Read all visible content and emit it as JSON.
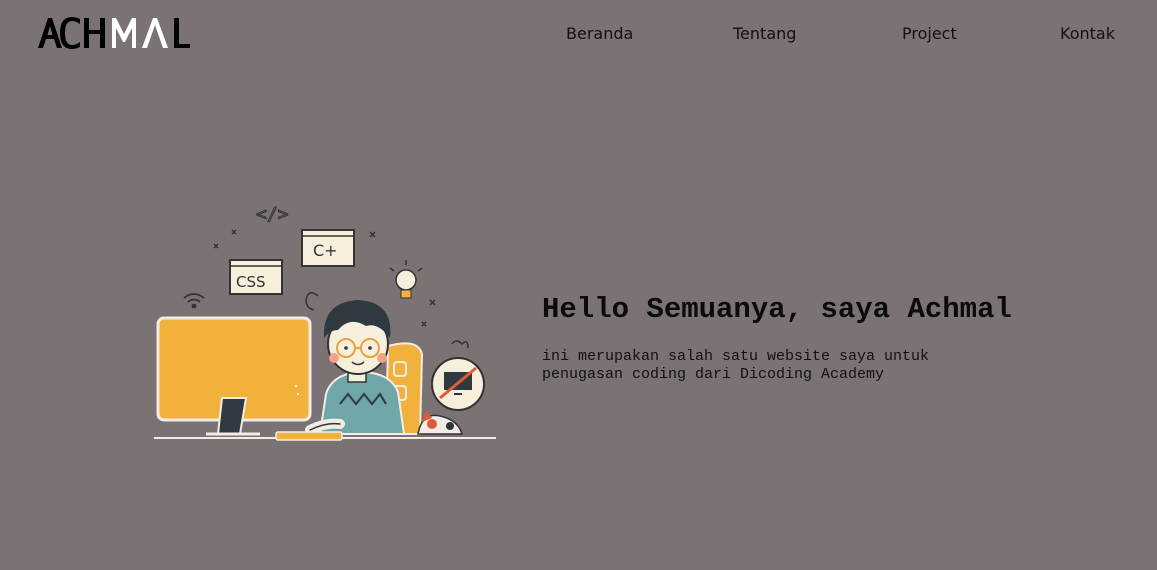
{
  "header": {
    "logo": {
      "text": "ACHMAL",
      "prefix": "ACH",
      "suffix": "MAL"
    },
    "nav": [
      {
        "label": "Beranda"
      },
      {
        "label": "Tentang"
      },
      {
        "label": "Project"
      },
      {
        "label": "Kontak"
      }
    ]
  },
  "hero": {
    "title": "Hello Semuanya, saya Achmal",
    "description": "ini merupakan salah satu website saya untuk penugasan coding dari Dicoding Academy",
    "illustration": {
      "subject": "person-coding-at-computer",
      "code_tags": [
        "</>",
        "CSS",
        "C+"
      ],
      "icons": [
        "wifi-icon",
        "lightbulb-icon",
        "no-screen-icon",
        "cat-icon",
        "sparkle-icon"
      ]
    }
  },
  "colors": {
    "background": "#7b7373",
    "text": "#111111",
    "logo_white": "#ffffff",
    "accent_yellow": "#f2b13a",
    "shirt_teal": "#6fa6a8"
  }
}
